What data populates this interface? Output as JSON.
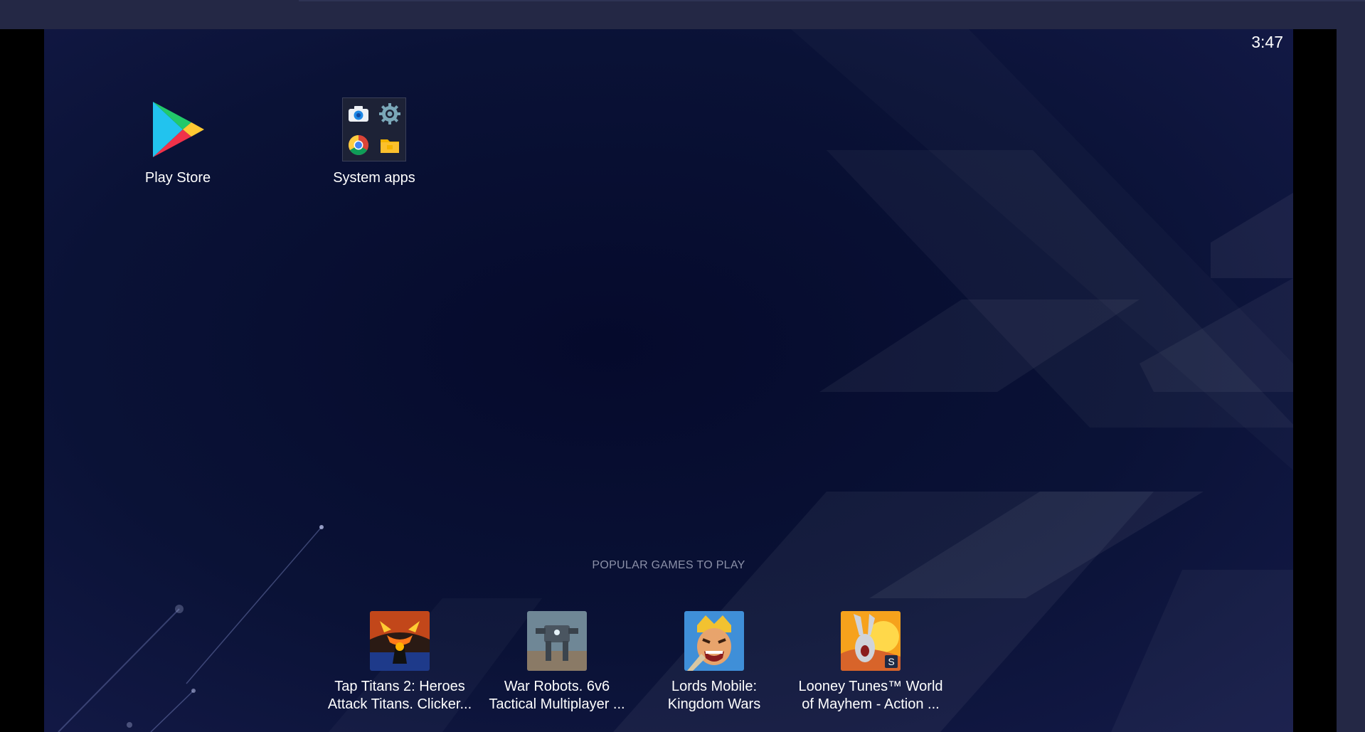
{
  "status_bar": {
    "time": "3:47"
  },
  "apps": [
    {
      "label": "Play Store",
      "icon": "play-store-icon"
    },
    {
      "label": "System apps",
      "icon": "folder-icon",
      "contents": [
        "camera-icon",
        "settings-icon",
        "chrome-icon",
        "files-icon"
      ]
    }
  ],
  "popular": {
    "title": "POPULAR GAMES TO PLAY",
    "games": [
      {
        "name_line1": "Tap Titans 2: Heroes",
        "name_line2": "Attack Titans. Clicker...",
        "icon": "tap-titans-icon"
      },
      {
        "name_line1": "War Robots. 6v6",
        "name_line2": "Tactical Multiplayer ...",
        "icon": "war-robots-icon"
      },
      {
        "name_line1": "Lords Mobile:",
        "name_line2": "Kingdom Wars",
        "icon": "lords-mobile-icon"
      },
      {
        "name_line1": "Looney Tunes™ World",
        "name_line2": "of Mayhem - Action ...",
        "icon": "looney-tunes-icon"
      }
    ]
  },
  "colors": {
    "wallpaper": "#0a1236",
    "window_frame": "#242845",
    "label": "#ffffff",
    "section_title": "#8b90a8"
  }
}
